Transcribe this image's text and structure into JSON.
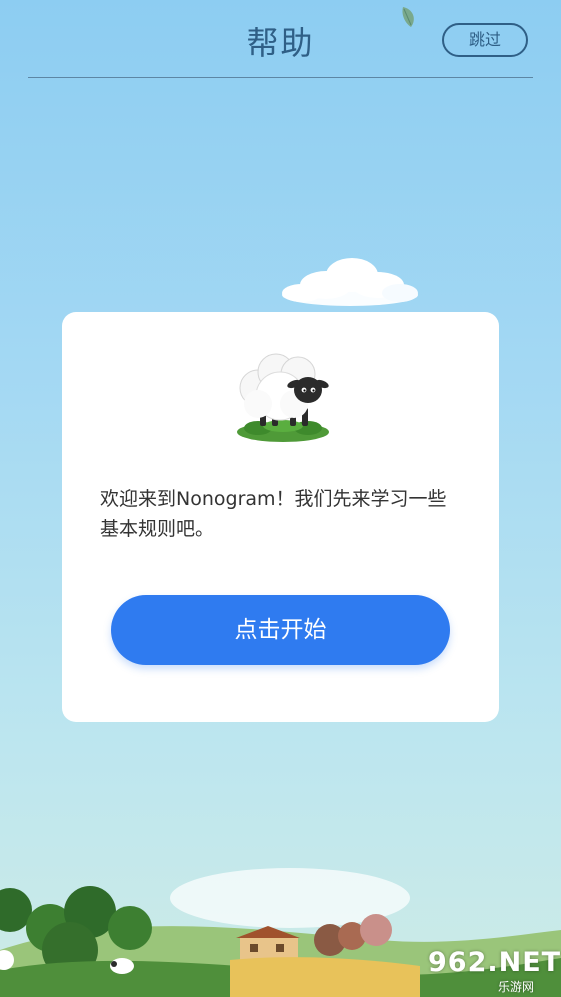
{
  "header": {
    "title": "帮助",
    "skip_label": "跳过"
  },
  "dialog": {
    "welcome_text": "欢迎来到Nonogram！我们先来学习一些基本规则吧。",
    "start_label": "点击开始"
  },
  "watermark": {
    "logo_text": "962.NET",
    "sub_text": "乐游网"
  },
  "colors": {
    "accent": "#2f7bf0",
    "header_text": "#2f5f86",
    "sky_top": "#8dcdf2",
    "sky_bottom": "#cdebe6",
    "dialog_bg": "#ffffff"
  },
  "icons": {
    "leaf": "leaf-icon",
    "sheep": "sheep-icon"
  }
}
